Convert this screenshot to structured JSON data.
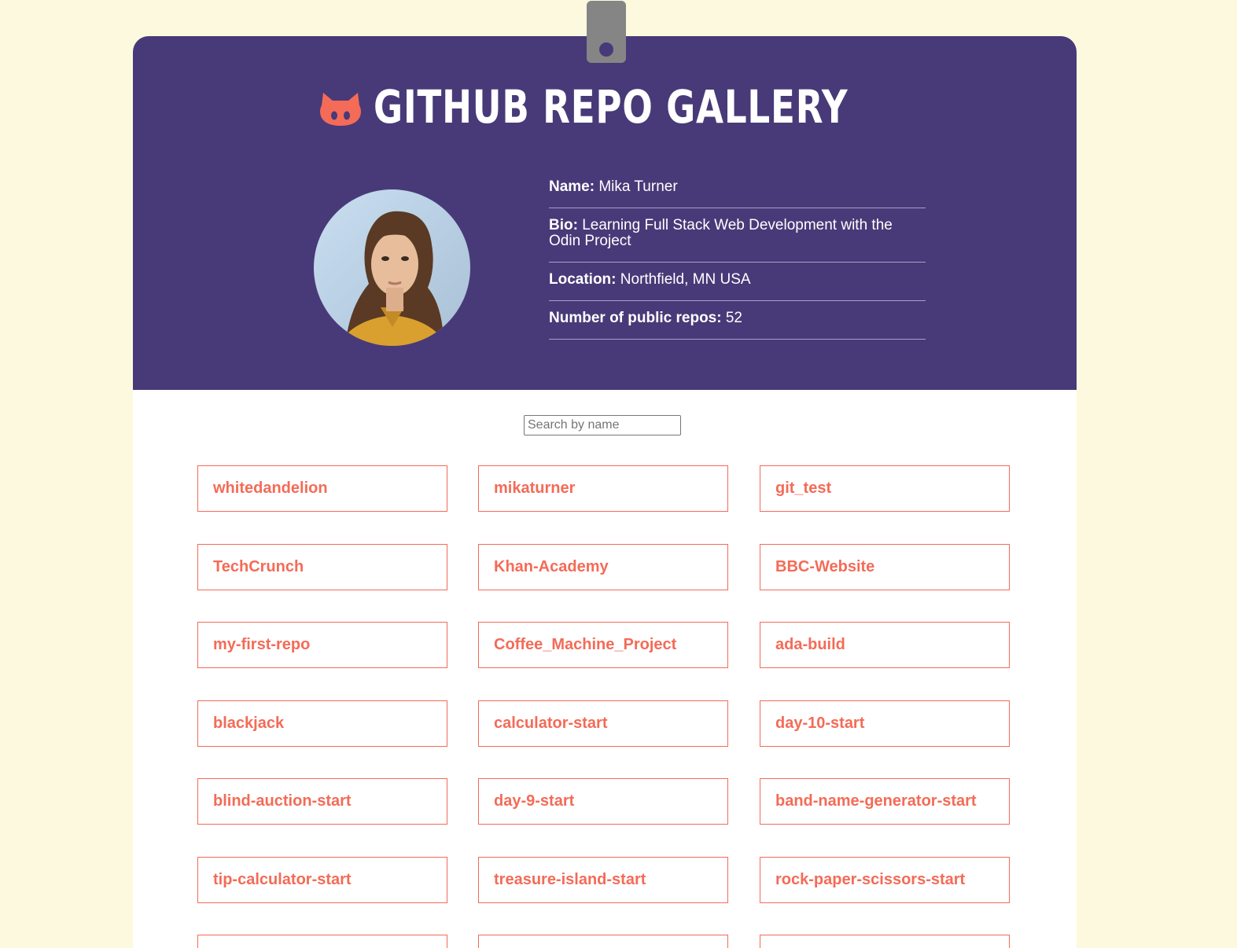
{
  "header": {
    "title": "GITHUB REPO GALLERY",
    "icon": "octocat-icon",
    "accent_color": "#f46b57",
    "background_color": "#483a78"
  },
  "profile": {
    "name_label": "Name:",
    "name": "Mika Turner",
    "bio_label": "Bio:",
    "bio": "Learning Full Stack Web Development with the Odin Project",
    "location_label": "Location:",
    "location": "Northfield, MN USA",
    "repos_label": "Number of public repos:",
    "repos_count": "52"
  },
  "search": {
    "placeholder": "Search by name",
    "value": ""
  },
  "repos": [
    "whitedandelion",
    "mikaturner",
    "git_test",
    "TechCrunch",
    "Khan-Academy",
    "BBC-Website",
    "my-first-repo",
    "Coffee_Machine_Project",
    "ada-build",
    "blackjack",
    "calculator-start",
    "day-10-start",
    "blind-auction-start",
    "day-9-start",
    "band-name-generator-start",
    "tip-calculator-start",
    "treasure-island-start",
    "rock-paper-scissors-start",
    "",
    "",
    ""
  ]
}
